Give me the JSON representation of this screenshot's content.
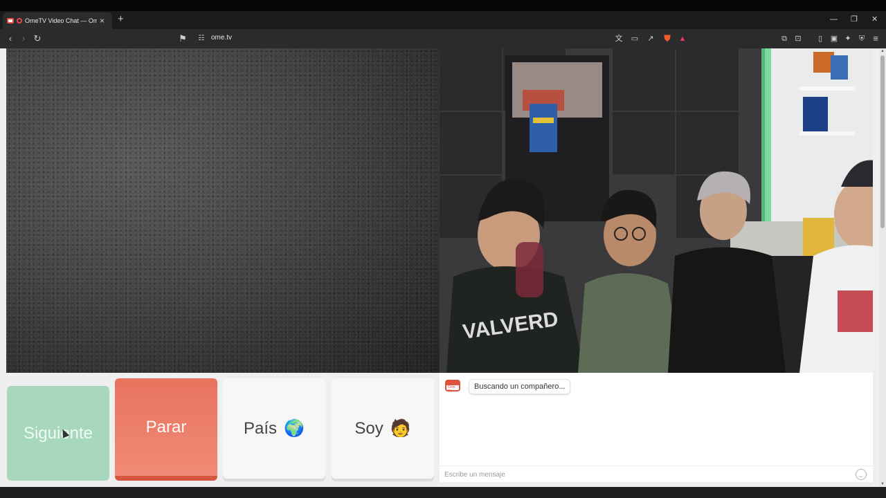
{
  "browser": {
    "tab_title": "OmeTV Video Chat — Omeg",
    "url": "ome.tv"
  },
  "buttons": {
    "next": "Siguiente",
    "stop": "Parar",
    "country": "País",
    "country_emoji": "🌍",
    "soy": "Soy",
    "soy_emoji": "🧑"
  },
  "chat": {
    "logo_text": "Ome TV",
    "status_message": "Buscando un compañero...",
    "input_placeholder": "Escribe un mensaje"
  },
  "colors": {
    "next_button": "#a7d8bd",
    "stop_button": "#e8735d",
    "brand": "#e0513b"
  },
  "icons": [
    "back-icon",
    "forward-icon",
    "reload-icon",
    "bookmark-icon",
    "site-info-icon",
    "translate-icon",
    "cast-icon",
    "share-icon",
    "brave-shield-icon",
    "brave-rewards-icon",
    "extensions-icon",
    "sidebar-icon",
    "wallet-icon",
    "leo-ai-icon",
    "vpn-icon",
    "menu-icon"
  ]
}
